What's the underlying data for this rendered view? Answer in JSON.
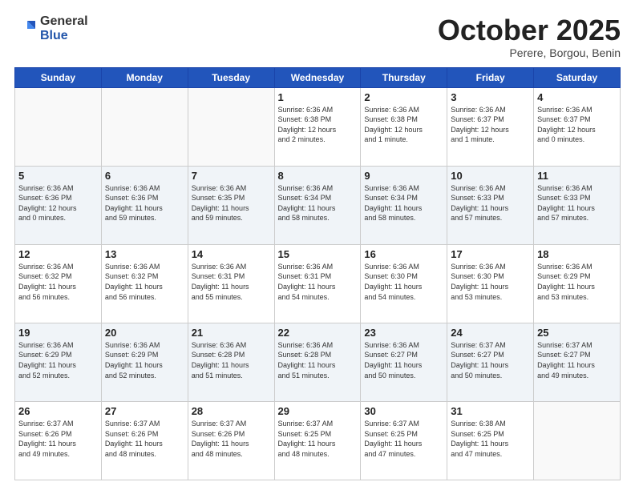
{
  "header": {
    "logo_general": "General",
    "logo_blue": "Blue",
    "title": "October 2025",
    "location": "Perere, Borgou, Benin"
  },
  "weekdays": [
    "Sunday",
    "Monday",
    "Tuesday",
    "Wednesday",
    "Thursday",
    "Friday",
    "Saturday"
  ],
  "weeks": [
    [
      {
        "day": "",
        "info": ""
      },
      {
        "day": "",
        "info": ""
      },
      {
        "day": "",
        "info": ""
      },
      {
        "day": "1",
        "info": "Sunrise: 6:36 AM\nSunset: 6:38 PM\nDaylight: 12 hours\nand 2 minutes."
      },
      {
        "day": "2",
        "info": "Sunrise: 6:36 AM\nSunset: 6:38 PM\nDaylight: 12 hours\nand 1 minute."
      },
      {
        "day": "3",
        "info": "Sunrise: 6:36 AM\nSunset: 6:37 PM\nDaylight: 12 hours\nand 1 minute."
      },
      {
        "day": "4",
        "info": "Sunrise: 6:36 AM\nSunset: 6:37 PM\nDaylight: 12 hours\nand 0 minutes."
      }
    ],
    [
      {
        "day": "5",
        "info": "Sunrise: 6:36 AM\nSunset: 6:36 PM\nDaylight: 12 hours\nand 0 minutes."
      },
      {
        "day": "6",
        "info": "Sunrise: 6:36 AM\nSunset: 6:36 PM\nDaylight: 11 hours\nand 59 minutes."
      },
      {
        "day": "7",
        "info": "Sunrise: 6:36 AM\nSunset: 6:35 PM\nDaylight: 11 hours\nand 59 minutes."
      },
      {
        "day": "8",
        "info": "Sunrise: 6:36 AM\nSunset: 6:34 PM\nDaylight: 11 hours\nand 58 minutes."
      },
      {
        "day": "9",
        "info": "Sunrise: 6:36 AM\nSunset: 6:34 PM\nDaylight: 11 hours\nand 58 minutes."
      },
      {
        "day": "10",
        "info": "Sunrise: 6:36 AM\nSunset: 6:33 PM\nDaylight: 11 hours\nand 57 minutes."
      },
      {
        "day": "11",
        "info": "Sunrise: 6:36 AM\nSunset: 6:33 PM\nDaylight: 11 hours\nand 57 minutes."
      }
    ],
    [
      {
        "day": "12",
        "info": "Sunrise: 6:36 AM\nSunset: 6:32 PM\nDaylight: 11 hours\nand 56 minutes."
      },
      {
        "day": "13",
        "info": "Sunrise: 6:36 AM\nSunset: 6:32 PM\nDaylight: 11 hours\nand 56 minutes."
      },
      {
        "day": "14",
        "info": "Sunrise: 6:36 AM\nSunset: 6:31 PM\nDaylight: 11 hours\nand 55 minutes."
      },
      {
        "day": "15",
        "info": "Sunrise: 6:36 AM\nSunset: 6:31 PM\nDaylight: 11 hours\nand 54 minutes."
      },
      {
        "day": "16",
        "info": "Sunrise: 6:36 AM\nSunset: 6:30 PM\nDaylight: 11 hours\nand 54 minutes."
      },
      {
        "day": "17",
        "info": "Sunrise: 6:36 AM\nSunset: 6:30 PM\nDaylight: 11 hours\nand 53 minutes."
      },
      {
        "day": "18",
        "info": "Sunrise: 6:36 AM\nSunset: 6:29 PM\nDaylight: 11 hours\nand 53 minutes."
      }
    ],
    [
      {
        "day": "19",
        "info": "Sunrise: 6:36 AM\nSunset: 6:29 PM\nDaylight: 11 hours\nand 52 minutes."
      },
      {
        "day": "20",
        "info": "Sunrise: 6:36 AM\nSunset: 6:29 PM\nDaylight: 11 hours\nand 52 minutes."
      },
      {
        "day": "21",
        "info": "Sunrise: 6:36 AM\nSunset: 6:28 PM\nDaylight: 11 hours\nand 51 minutes."
      },
      {
        "day": "22",
        "info": "Sunrise: 6:36 AM\nSunset: 6:28 PM\nDaylight: 11 hours\nand 51 minutes."
      },
      {
        "day": "23",
        "info": "Sunrise: 6:36 AM\nSunset: 6:27 PM\nDaylight: 11 hours\nand 50 minutes."
      },
      {
        "day": "24",
        "info": "Sunrise: 6:37 AM\nSunset: 6:27 PM\nDaylight: 11 hours\nand 50 minutes."
      },
      {
        "day": "25",
        "info": "Sunrise: 6:37 AM\nSunset: 6:27 PM\nDaylight: 11 hours\nand 49 minutes."
      }
    ],
    [
      {
        "day": "26",
        "info": "Sunrise: 6:37 AM\nSunset: 6:26 PM\nDaylight: 11 hours\nand 49 minutes."
      },
      {
        "day": "27",
        "info": "Sunrise: 6:37 AM\nSunset: 6:26 PM\nDaylight: 11 hours\nand 48 minutes."
      },
      {
        "day": "28",
        "info": "Sunrise: 6:37 AM\nSunset: 6:26 PM\nDaylight: 11 hours\nand 48 minutes."
      },
      {
        "day": "29",
        "info": "Sunrise: 6:37 AM\nSunset: 6:25 PM\nDaylight: 11 hours\nand 48 minutes."
      },
      {
        "day": "30",
        "info": "Sunrise: 6:37 AM\nSunset: 6:25 PM\nDaylight: 11 hours\nand 47 minutes."
      },
      {
        "day": "31",
        "info": "Sunrise: 6:38 AM\nSunset: 6:25 PM\nDaylight: 11 hours\nand 47 minutes."
      },
      {
        "day": "",
        "info": ""
      }
    ]
  ]
}
